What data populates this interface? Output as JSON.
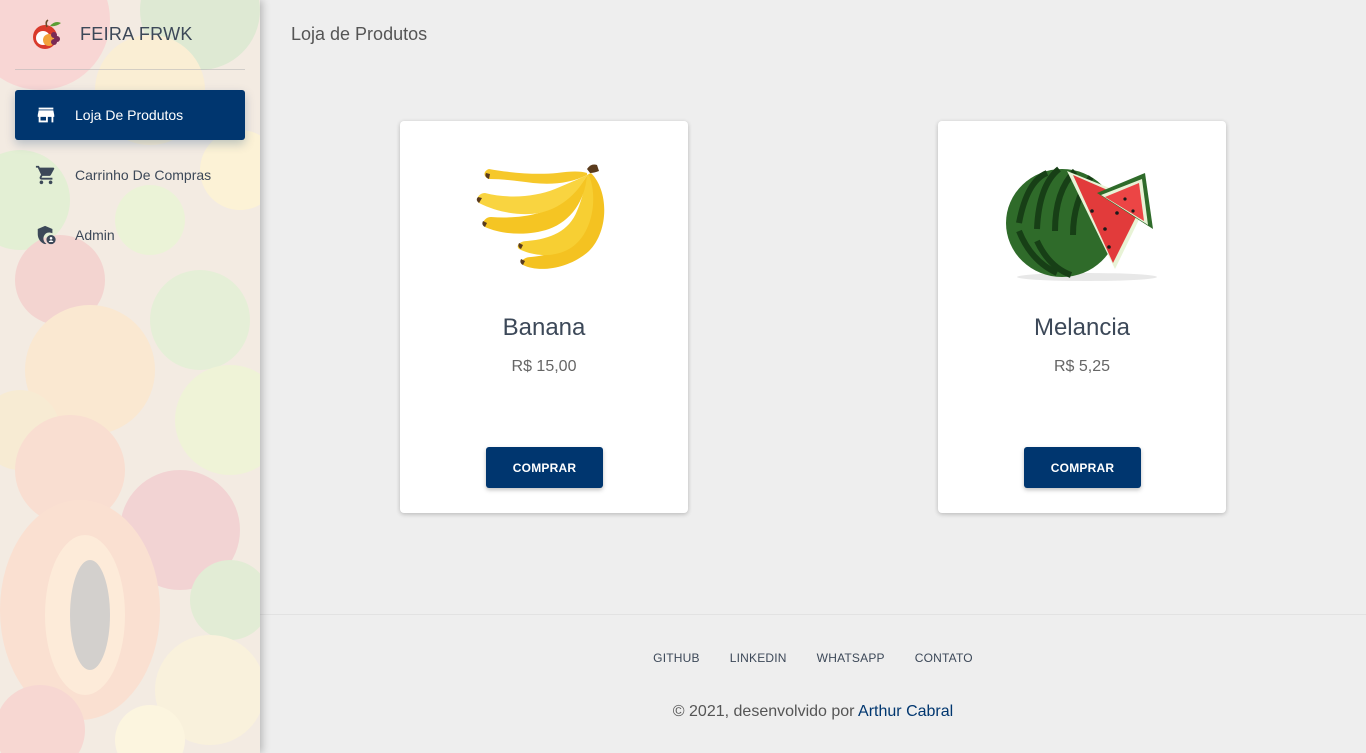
{
  "brand": {
    "name": "FEIRA FRWK",
    "logo_icon": "fruit-basket-logo"
  },
  "sidebar": {
    "items": [
      {
        "label": "Loja De Produtos",
        "icon": "store-icon",
        "active": true
      },
      {
        "label": "Carrinho De Compras",
        "icon": "cart-icon",
        "active": false
      },
      {
        "label": "Admin",
        "icon": "admin-shield-icon",
        "active": false
      }
    ]
  },
  "main": {
    "title": "Loja de Produtos",
    "products": [
      {
        "name": "Banana",
        "price": "R$ 15,00",
        "button": "COMPRAR",
        "image_icon": "banana-image"
      },
      {
        "name": "Melancia",
        "price": "R$ 5,25",
        "button": "COMPRAR",
        "image_icon": "watermelon-image"
      }
    ]
  },
  "footer": {
    "links": [
      "GITHUB",
      "LINKEDIN",
      "WHATSAPP",
      "CONTATO"
    ],
    "copyright_prefix": "© 2021, desenvolvido por ",
    "author": "Arthur Cabral"
  },
  "colors": {
    "primary": "#00366f",
    "background": "#eeeeee",
    "text": "#3c4858"
  }
}
